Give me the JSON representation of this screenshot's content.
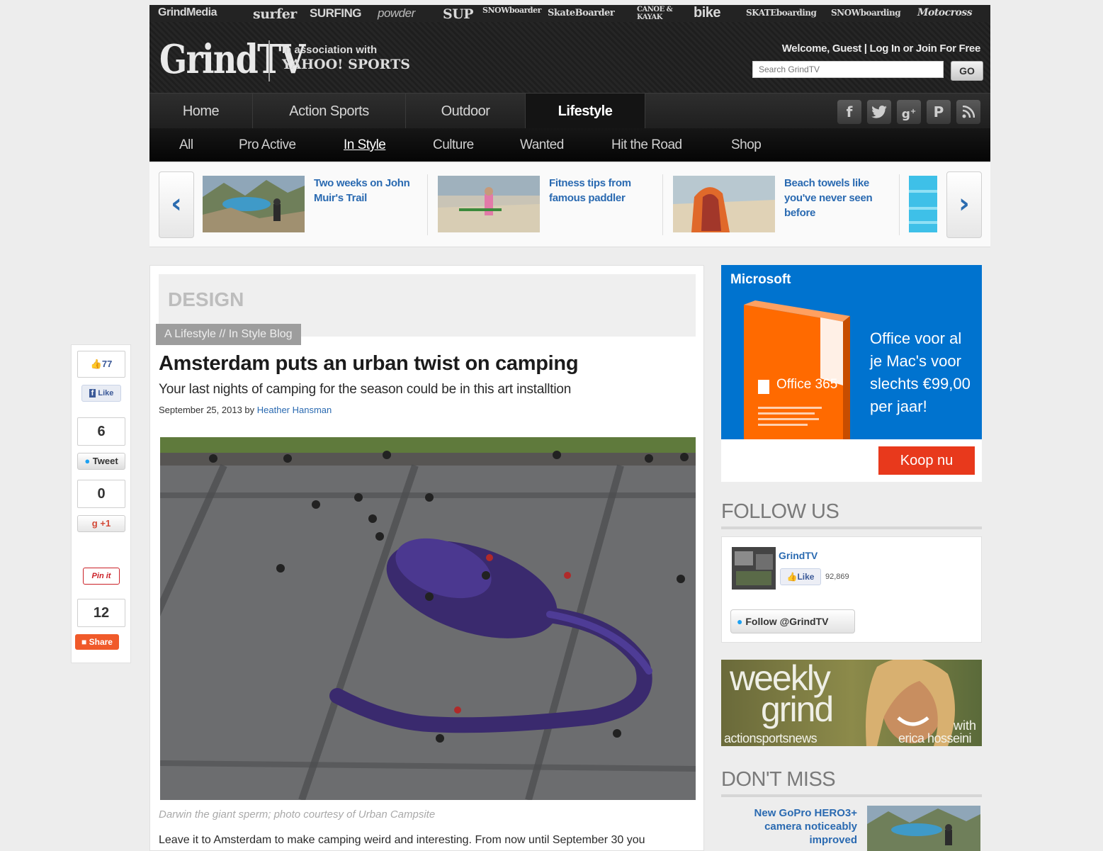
{
  "header": {
    "network_links": [
      "GrindMedia",
      "surfer",
      "SURFING",
      "powder",
      "SUP",
      "SNOWboarder",
      "SkateBoarder",
      "CANOE & KAYAK",
      "bike",
      "SKATEboarding",
      "SNOWboarding",
      "Motocross"
    ],
    "logo": "GrindTV",
    "assoc_line1": "In association with",
    "assoc_line2": "YAHOO! SPORTS",
    "welcome": "Welcome, Guest | Log In or Join For Free",
    "search_placeholder": "Search GrindTV",
    "go_label": "GO"
  },
  "main_nav": {
    "tabs": [
      "Home",
      "Action Sports",
      "Outdoor",
      "Lifestyle"
    ],
    "active": "Lifestyle",
    "social_icons": [
      "facebook-icon",
      "twitter-icon",
      "google-plus-icon",
      "pinterest-icon",
      "rss-icon"
    ]
  },
  "sub_nav": {
    "items": [
      "All",
      "Pro Active",
      "In Style",
      "Culture",
      "Wanted",
      "Hit the Road",
      "Shop"
    ],
    "active": "In Style"
  },
  "carousel": {
    "items": [
      {
        "title": "Two weeks on John Muir's Trail"
      },
      {
        "title": "Fitness tips from famous paddler"
      },
      {
        "title": "Beach towels like you've never seen before"
      }
    ]
  },
  "article": {
    "section": "DESIGN",
    "category": "A Lifestyle // In Style Blog",
    "headline": "Amsterdam puts an urban twist on camping",
    "subheadline": "Your last nights of camping for the season could be in this art installtion",
    "date": "September 25, 2013 by ",
    "author": "Heather Hansman",
    "caption": "Darwin the giant sperm; photo courtesy of Urban Campsite",
    "body_start": "Leave it to Amsterdam to make camping weird and interesting. From now until September 30 you"
  },
  "share": {
    "like_count": "77",
    "like_label": "Like",
    "tweet_count": "6",
    "tweet_label": "Tweet",
    "gplus_count": "0",
    "gplus_label": "+1",
    "pin_label": "Pin it",
    "share_count": "12",
    "share_label": "Share"
  },
  "sidebar": {
    "ad": {
      "brand": "Microsoft",
      "product": "Office 365",
      "copy": "Office voor al je Mac's voor slechts €99,00 per jaar!",
      "cta": "Koop nu"
    },
    "follow_heading": "FOLLOW US",
    "follow": {
      "page_name": "GrindTV",
      "like_label": "Like",
      "like_count": "92,869",
      "twitter_label": "Follow @GrindTV"
    },
    "weekly": {
      "title1": "weekly",
      "title2": "grind",
      "sub": "actionsportsnews",
      "with": "with",
      "host": "erica hosseini"
    },
    "dontmiss_heading": "DON'T MISS",
    "dontmiss_item": "New GoPro HERO3+ camera noticeably improved"
  },
  "colors": {
    "link_blue": "#2a6ab1",
    "header_dark": "#1b1b1b",
    "ad_blue": "#0073cf",
    "ad_orange": "#ff6a00",
    "cta_red": "#e8391c"
  }
}
